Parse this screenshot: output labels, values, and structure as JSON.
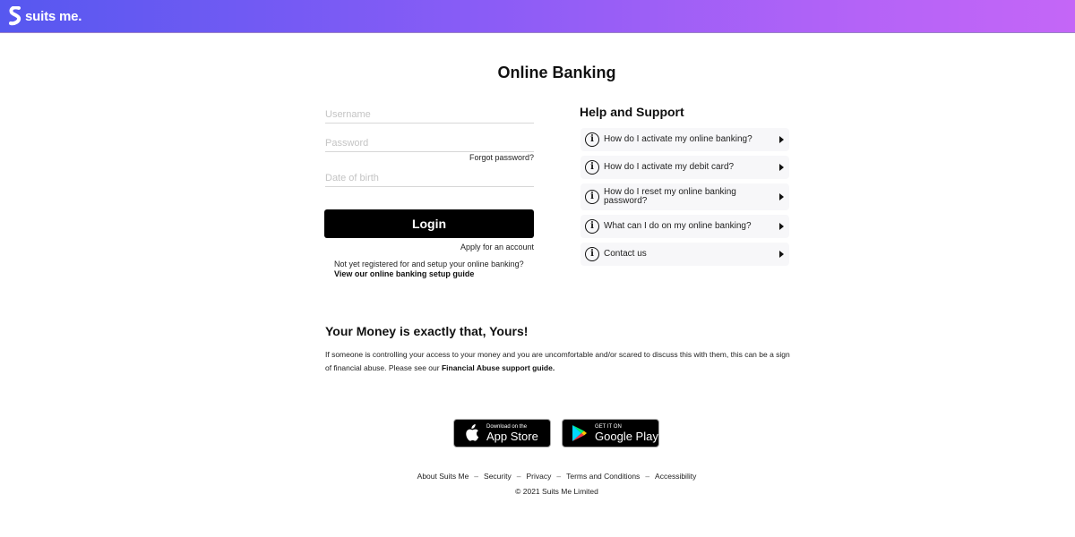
{
  "header": {
    "brand": "suits me.",
    "gradient_colors": [
      "#5658f0",
      "#8a5cf6",
      "#c466f7"
    ]
  },
  "page_title": "Online Banking",
  "login_form": {
    "username_placeholder": "Username",
    "password_placeholder": "Password",
    "dob_placeholder": "Date of birth",
    "forgot_password": "Forgot password?",
    "login_button": "Login",
    "apply_link": "Apply for an account",
    "not_registered_text": "Not yet registered for and setup your online banking?",
    "setup_guide_link": "View our online banking setup guide"
  },
  "help": {
    "title": "Help and Support",
    "items": [
      {
        "icon": "info-icon",
        "label": "How do I activate my online banking?"
      },
      {
        "icon": "info-icon",
        "label": "How do I activate my debit card?"
      },
      {
        "icon": "info-icon",
        "label": "How do I reset my online banking password?"
      },
      {
        "icon": "info-icon",
        "label": "What can I do on my online banking?"
      },
      {
        "icon": "info-icon",
        "label": "Contact us"
      }
    ]
  },
  "money": {
    "title": "Your Money is exactly that, Yours!",
    "text": "If someone is controlling your access to your money and you are uncomfortable and/or scared to discuss this with them, this can be a sign of financial abuse. Please see our ",
    "link": "Financial Abuse support guide."
  },
  "stores": {
    "appstore_small": "Download on the",
    "appstore_big": "App Store",
    "google_small": "GET IT ON",
    "google_big": "Google Play"
  },
  "footer": {
    "links": [
      "About Suits Me",
      "Security",
      "Privacy",
      "Terms and Conditions",
      "Accessibility"
    ],
    "separator": "–",
    "copyright": "© 2021 Suits Me Limited"
  }
}
